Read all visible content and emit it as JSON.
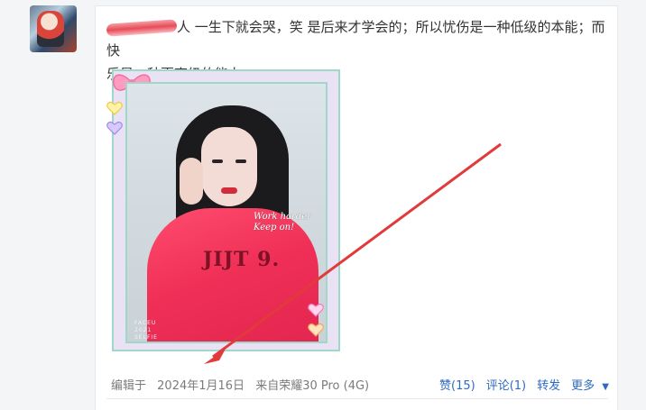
{
  "post": {
    "author_hidden": "",
    "text_line1": "人 一生下就会哭，笑 是后来才学会的；所以忧伤是一种低级的本能；而快",
    "text_line2": "乐是一种更高级的能力。",
    "image": {
      "overlay_line1": "Work harder",
      "overlay_line2": "Keep on!",
      "watermark_line1": "FACEU",
      "watermark_line2": "2021",
      "watermark_line3": "SELFIE",
      "hoodie_print": "JIJT 9."
    }
  },
  "footer": {
    "edited_label": "编辑于",
    "date": "2024年1月16日",
    "source": "来自荣耀30 Pro (4G)",
    "like": "赞(15)",
    "comment": "评论(1)",
    "share": "转发",
    "more": "更多",
    "more_icon": "▼"
  },
  "annotation": {
    "arrow_color": "#e23a3a"
  },
  "colors": {
    "link": "#2e6bbf",
    "text": "#333333",
    "meta": "#7b7b7b"
  }
}
